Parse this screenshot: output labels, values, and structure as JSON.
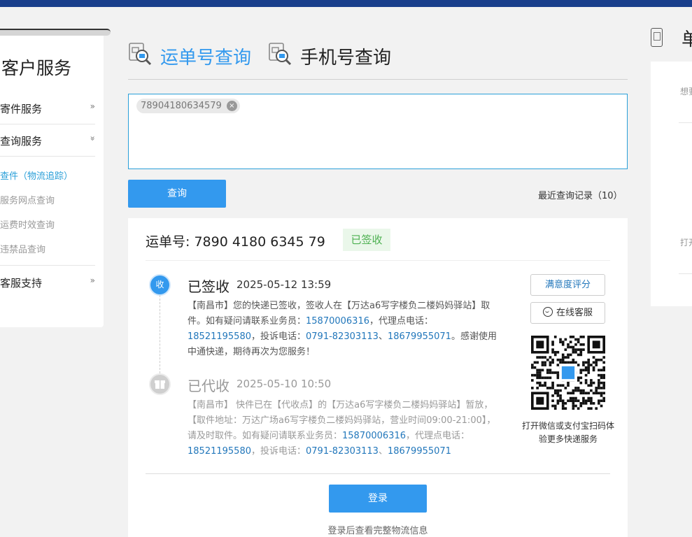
{
  "sidebar": {
    "title": "客户服务",
    "sections": [
      {
        "label": "寄件服务",
        "chevron": "»"
      },
      {
        "label": "查询服务",
        "chevron": "»"
      }
    ],
    "sub_items": [
      {
        "label": "查件（物流追踪）",
        "active": true
      },
      {
        "label": "服务网点查询",
        "active": false
      },
      {
        "label": "运费时效查询",
        "active": false
      },
      {
        "label": "违禁品查询",
        "active": false
      }
    ],
    "support": {
      "label": "客服支持",
      "chevron": "»"
    }
  },
  "tabs": [
    {
      "label": "运单号查询",
      "active": true,
      "icon": "magnifier-document-icon"
    },
    {
      "label": "手机号查询",
      "active": false,
      "icon": "magnifier-document-icon"
    }
  ],
  "query": {
    "chip": "78904180634579",
    "chip_remove_glyph": "×",
    "button_label": "查询",
    "recent_label": "最近查询记录（10）"
  },
  "result": {
    "waybill_label": "运单号: 7890 4180 6345 79",
    "status_badge": "已签收",
    "events": [
      {
        "dot_label": "收",
        "status": "已签收",
        "time": "2025-05-12 13:59",
        "text_parts": [
          {
            "t": "【南昌市】您的快递已签收，签收人在【万达a6写字楼负二楼妈妈驿站】取件。如有疑问请联系业务员：",
            "link": false
          },
          {
            "t": "15870006316",
            "link": true
          },
          {
            "t": "，代理点电话：",
            "link": false
          },
          {
            "t": "18521195580",
            "link": true
          },
          {
            "t": "，投诉电话：",
            "link": false
          },
          {
            "t": "0791-82303113",
            "link": true
          },
          {
            "t": "、",
            "link": false
          },
          {
            "t": "18679955071",
            "link": true
          },
          {
            "t": "。感谢使用中通快递，期待再次为您服务！",
            "link": false
          }
        ]
      },
      {
        "dot_label": "gift-icon",
        "status": "已代收",
        "time": "2025-05-10 10:50",
        "text_parts": [
          {
            "t": "【南昌市】 快件已在【代收点】的【万达a6写字楼负二楼妈妈驿站】暂放，【取件地址：万达广场a6写字楼负二楼妈妈驿站，营业时间09:00-21:00】，请及时取件。如有疑问请联系业务员：",
            "link": false
          },
          {
            "t": "15870006316",
            "link": true
          },
          {
            "t": "，代理点电话：",
            "link": false
          },
          {
            "t": "18521195580",
            "link": true
          },
          {
            "t": "，投诉电话：",
            "link": false
          },
          {
            "t": "0791-82303113",
            "link": true
          },
          {
            "t": "、",
            "link": false
          },
          {
            "t": "18679955071",
            "link": true
          }
        ]
      }
    ],
    "rate_button": "满意度评分",
    "online_service_button": "在线客服",
    "qr_caption": "打开微信或支付宝扫码体验更多快递服务",
    "login_button": "登录",
    "login_hint": "登录后查看完整物流信息"
  },
  "right_panel": {
    "title": "单",
    "text1": "想要",
    "text2": "打开"
  },
  "colors": {
    "accent": "#3399ee",
    "link": "#2277bb",
    "signed_green": "#4cb050",
    "topbar": "#1a3f8c"
  }
}
